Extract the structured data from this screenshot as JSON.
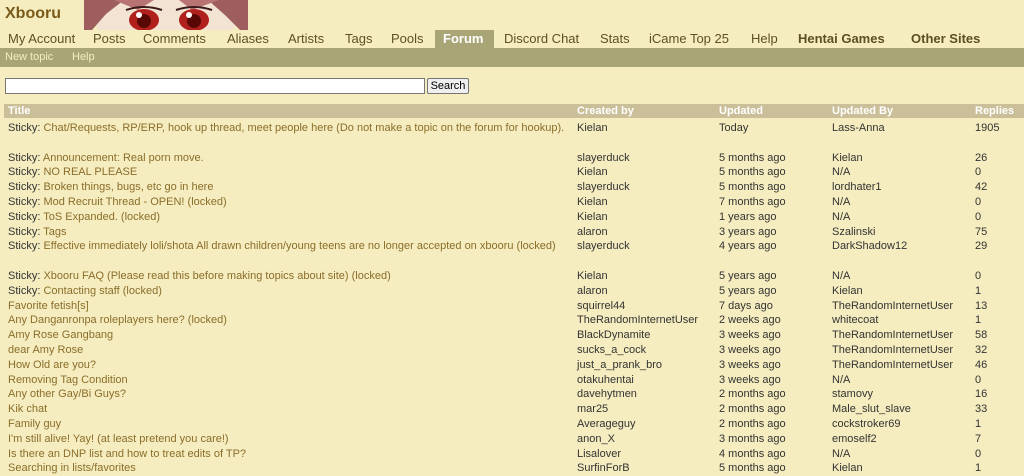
{
  "site": {
    "logo": "Xbooru"
  },
  "nav": {
    "items": [
      {
        "label": "My Account"
      },
      {
        "label": "Posts"
      },
      {
        "label": "Comments"
      },
      {
        "label": "Aliases"
      },
      {
        "label": "Artists"
      },
      {
        "label": "Tags"
      },
      {
        "label": "Pools"
      },
      {
        "label": "Forum"
      },
      {
        "label": "Discord Chat"
      },
      {
        "label": "Stats"
      },
      {
        "label": "iCame Top 25"
      },
      {
        "label": "Help"
      },
      {
        "label": "Hentai Games"
      },
      {
        "label": "Other Sites"
      }
    ],
    "active": "Forum"
  },
  "subnav": {
    "new_topic": "New topic",
    "help": "Help"
  },
  "search": {
    "value": "",
    "button": "Search"
  },
  "table": {
    "headers": {
      "title": "Title",
      "created_by": "Created by",
      "updated": "Updated",
      "updated_by": "Updated By",
      "replies": "Replies"
    },
    "rows": [
      {
        "prefix": "Sticky:",
        "title": "Chat/Requests, RP/ERP, hook up thread, meet people here (Do not make a topic on the forum for hookup).",
        "created_by": "Kielan",
        "updated": "Today",
        "updated_by": "Lass-Anna",
        "replies": "1905"
      },
      {
        "prefix": "Sticky:",
        "title": "Announcement: Real porn move.",
        "created_by": "slayerduck",
        "updated": "5 months ago",
        "updated_by": "Kielan",
        "replies": "26"
      },
      {
        "prefix": "Sticky:",
        "title": "NO REAL PLEASE",
        "created_by": "Kielan",
        "updated": "5 months ago",
        "updated_by": "N/A",
        "replies": "0"
      },
      {
        "prefix": "Sticky:",
        "title": "Broken things, bugs, etc go in here",
        "created_by": "slayerduck",
        "updated": "5 months ago",
        "updated_by": "lordhater1",
        "replies": "42"
      },
      {
        "prefix": "Sticky:",
        "title": "Mod Recruit Thread - OPEN! (locked)",
        "created_by": "Kielan",
        "updated": "7 months ago",
        "updated_by": "N/A",
        "replies": "0"
      },
      {
        "prefix": "Sticky:",
        "title": "ToS Expanded. (locked)",
        "created_by": "Kielan",
        "updated": "1 years ago",
        "updated_by": "N/A",
        "replies": "0"
      },
      {
        "prefix": "Sticky:",
        "title": "Tags",
        "created_by": "alaron",
        "updated": "3 years ago",
        "updated_by": "Szalinski",
        "replies": "75"
      },
      {
        "prefix": "Sticky:",
        "title": "Effective immediately loli/shota All drawn children/young teens are no longer accepted on xbooru (locked)",
        "created_by": "slayerduck",
        "updated": "4 years ago",
        "updated_by": "DarkShadow12",
        "replies": "29"
      },
      {
        "prefix": "Sticky:",
        "title": "Xbooru FAQ (Please read this before making topics about site) (locked)",
        "created_by": "Kielan",
        "updated": "5 years ago",
        "updated_by": "N/A",
        "replies": "0"
      },
      {
        "prefix": "Sticky:",
        "title": "Contacting staff (locked)",
        "created_by": "alaron",
        "updated": "5 years ago",
        "updated_by": "Kielan",
        "replies": "1"
      },
      {
        "prefix": "",
        "title": "Favorite fetish[s]",
        "created_by": "squirrel44",
        "updated": "7 days ago",
        "updated_by": "TheRandomInternetUser",
        "replies": "13"
      },
      {
        "prefix": "",
        "title": "Any Danganronpa roleplayers here? (locked)",
        "created_by": "TheRandomInternetUser",
        "updated": "2 weeks ago",
        "updated_by": "whitecoat",
        "replies": "1"
      },
      {
        "prefix": "",
        "title": "Amy Rose Gangbang",
        "created_by": "BlackDynamite",
        "updated": "3 weeks ago",
        "updated_by": "TheRandomInternetUser",
        "replies": "58"
      },
      {
        "prefix": "",
        "title": "dear Amy Rose",
        "created_by": "sucks_a_cock",
        "updated": "3 weeks ago",
        "updated_by": "TheRandomInternetUser",
        "replies": "32"
      },
      {
        "prefix": "",
        "title": "How Old are you?",
        "created_by": "just_a_prank_bro",
        "updated": "3 weeks ago",
        "updated_by": "TheRandomInternetUser",
        "replies": "46"
      },
      {
        "prefix": "",
        "title": "Removing Tag Condition",
        "created_by": "otakuhentai",
        "updated": "3 weeks ago",
        "updated_by": "N/A",
        "replies": "0"
      },
      {
        "prefix": "",
        "title": "Any other Gay/Bi Guys?",
        "created_by": "davehytmen",
        "updated": "2 months ago",
        "updated_by": "stamovy",
        "replies": "16"
      },
      {
        "prefix": "",
        "title": "Kik chat",
        "created_by": "mar25",
        "updated": "2 months ago",
        "updated_by": "Male_slut_slave",
        "replies": "33"
      },
      {
        "prefix": "",
        "title": "Family guy",
        "created_by": "Averageguy",
        "updated": "2 months ago",
        "updated_by": "cockstroker69",
        "replies": "1"
      },
      {
        "prefix": "",
        "title": "I'm still alive! Yay! (at least pretend you care!)",
        "created_by": "anon_X",
        "updated": "3 months ago",
        "updated_by": "emoself2",
        "replies": "7"
      },
      {
        "prefix": "",
        "title": "Is there an DNP list and how to treat edits of TP?",
        "created_by": "Lisalover",
        "updated": "4 months ago",
        "updated_by": "N/A",
        "replies": "0"
      },
      {
        "prefix": "",
        "title": "Searching in lists/favorites",
        "created_by": "SurfinForB",
        "updated": "5 months ago",
        "updated_by": "Kielan",
        "replies": "1"
      }
    ]
  }
}
